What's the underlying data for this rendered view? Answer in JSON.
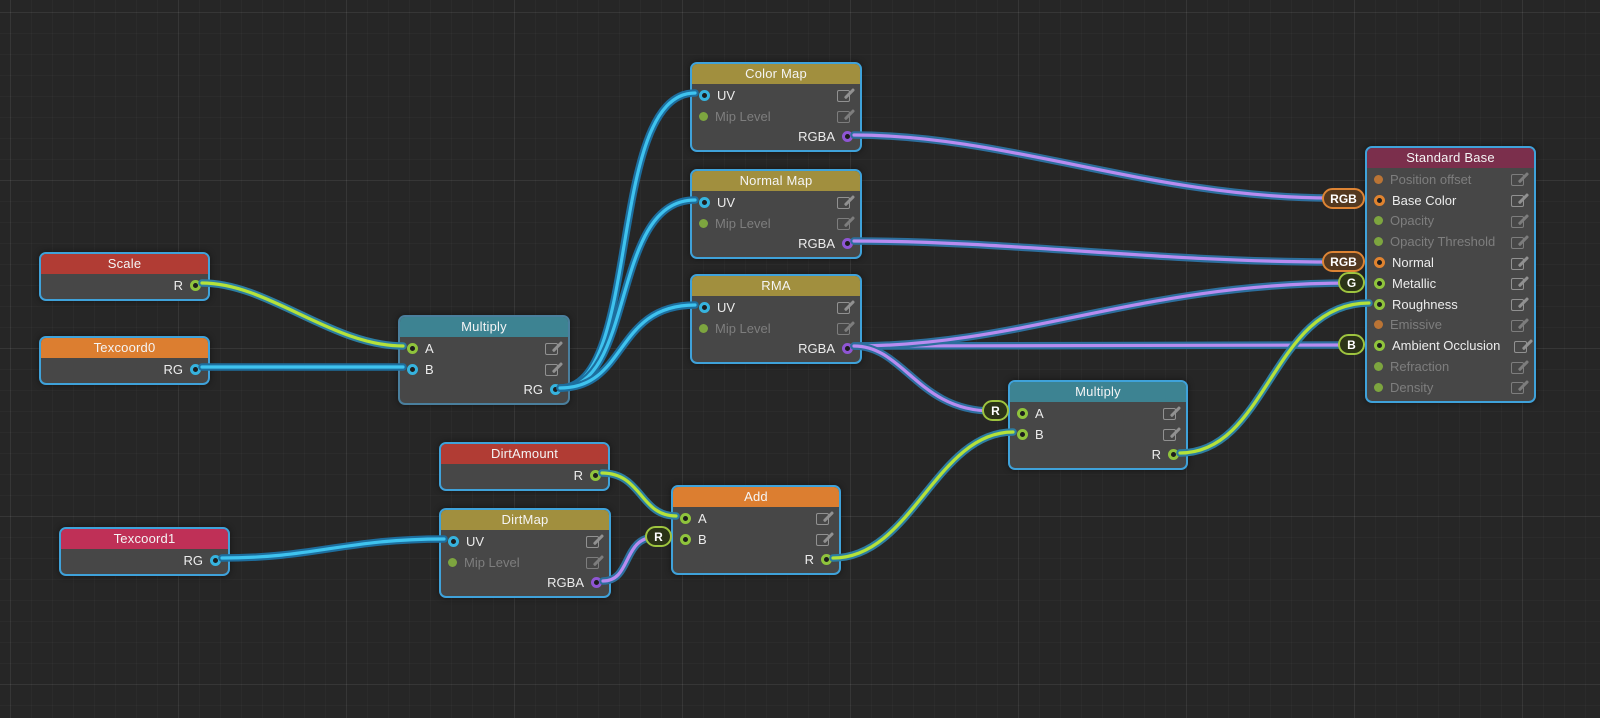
{
  "nodes": {
    "scale": {
      "title": "Scale",
      "outputs": [
        {
          "label": "R"
        }
      ]
    },
    "texcoord0": {
      "title": "Texcoord0",
      "outputs": [
        {
          "label": "RG"
        }
      ]
    },
    "texcoord1": {
      "title": "Texcoord1",
      "outputs": [
        {
          "label": "RG"
        }
      ]
    },
    "dirt_amount": {
      "title": "DirtAmount",
      "outputs": [
        {
          "label": "R"
        }
      ]
    },
    "multiply_uv": {
      "title": "Multiply",
      "inputs": [
        {
          "label": "A"
        },
        {
          "label": "B"
        }
      ],
      "outputs": [
        {
          "label": "RG"
        }
      ]
    },
    "color_map": {
      "title": "Color Map",
      "inputs": [
        {
          "label": "UV"
        },
        {
          "label": "Mip Level"
        }
      ],
      "outputs": [
        {
          "label": "RGBA"
        }
      ]
    },
    "normal_map": {
      "title": "Normal Map",
      "inputs": [
        {
          "label": "UV"
        },
        {
          "label": "Mip Level"
        }
      ],
      "outputs": [
        {
          "label": "RGBA"
        }
      ]
    },
    "rma": {
      "title": "RMA",
      "inputs": [
        {
          "label": "UV"
        },
        {
          "label": "Mip Level"
        }
      ],
      "outputs": [
        {
          "label": "RGBA"
        }
      ]
    },
    "dirt_map": {
      "title": "DirtMap",
      "inputs": [
        {
          "label": "UV"
        },
        {
          "label": "Mip Level"
        }
      ],
      "outputs": [
        {
          "label": "RGBA"
        }
      ]
    },
    "add": {
      "title": "Add",
      "inputs": [
        {
          "label": "A"
        },
        {
          "label": "B"
        }
      ],
      "outputs": [
        {
          "label": "R"
        }
      ]
    },
    "multiply_dirt": {
      "title": "Multiply",
      "inputs": [
        {
          "label": "A"
        },
        {
          "label": "B"
        }
      ],
      "outputs": [
        {
          "label": "R"
        }
      ]
    },
    "standard_base": {
      "title": "Standard Base",
      "inputs": [
        {
          "label": "Position offset"
        },
        {
          "label": "Base Color"
        },
        {
          "label": "Opacity"
        },
        {
          "label": "Opacity Threshold"
        },
        {
          "label": "Normal"
        },
        {
          "label": "Metallic"
        },
        {
          "label": "Roughness"
        },
        {
          "label": "Emissive"
        },
        {
          "label": "Ambient Occlusion"
        },
        {
          "label": "Refraction"
        },
        {
          "label": "Density"
        }
      ]
    }
  },
  "badges": {
    "base_color": "RGB",
    "normal": "RGB",
    "metallic": "G",
    "ambient_occlusion": "B",
    "multiply_dirt_a": "R",
    "add_b": "R"
  },
  "palette": {
    "background": "#262626",
    "node_body": "#474747",
    "node_border_selected": "#3fa2da",
    "node_border_unselected": "#4a7f9d",
    "header_red": "#b13c34",
    "header_orange": "#dc7e30",
    "header_crimson": "#bf3057",
    "header_olive": "#a18f3e",
    "header_teal": "#3d8392",
    "header_maroon": "#7b2f4c",
    "wire_cyan": "#3fc3ef",
    "wire_green": "#b5e23a",
    "wire_purple": "#b88cf0",
    "wire_outline": "#1d6e9e",
    "port_green": "#8fc43c",
    "port_cyan": "#36b3de",
    "port_purple": "#8f55d4",
    "port_orange": "#e0832f"
  }
}
